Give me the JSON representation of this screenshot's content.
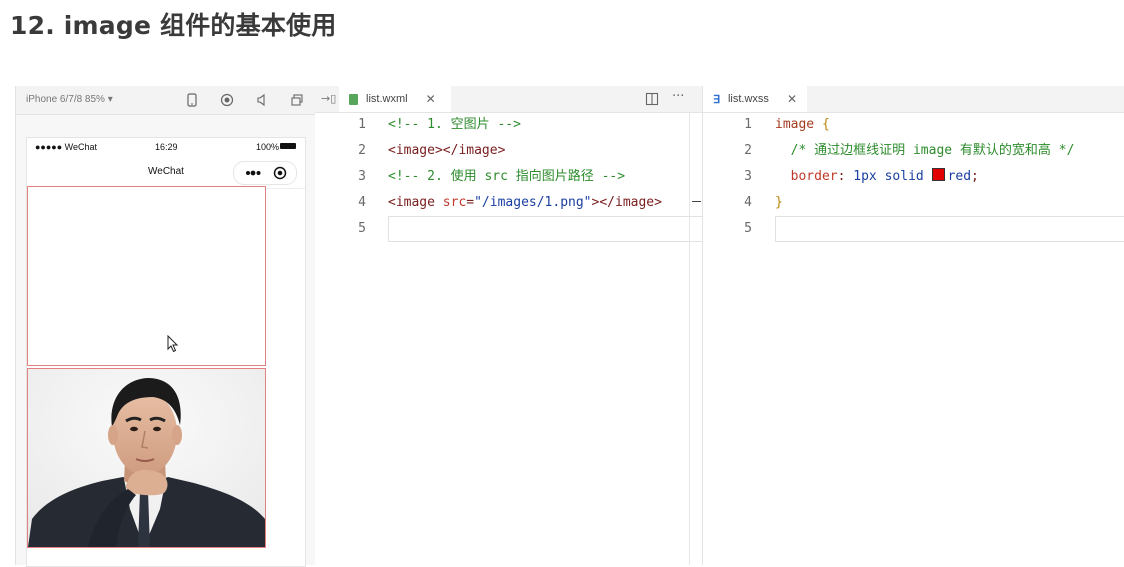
{
  "page_title": "12. image 组件的基本使用",
  "simulator": {
    "device_label": "iPhone 6/7/8 85% ▾",
    "status": {
      "carrier": "●●●●● WeChat",
      "time": "16:29",
      "battery": "100%"
    },
    "nav_title": "WeChat"
  },
  "wxml_editor": {
    "tab_label": "list.wxml",
    "file_icon": "wxml-file-icon",
    "lines": [
      {
        "no": "1",
        "parts": [
          {
            "t": "<!-- 1. 空图片 -->",
            "c": "c-comment"
          }
        ]
      },
      {
        "no": "2",
        "parts": [
          {
            "t": "<image></image>",
            "c": "c-tag"
          }
        ]
      },
      {
        "no": "3",
        "parts": [
          {
            "t": "<!-- 2. 使用 src 指向图片路径 -->",
            "c": "c-comment"
          }
        ]
      },
      {
        "no": "4",
        "parts": [
          {
            "t": "<image ",
            "c": "c-tag"
          },
          {
            "t": "src",
            "c": "c-attr"
          },
          {
            "t": "=",
            "c": "c-tag"
          },
          {
            "t": "\"/images/1.png\"",
            "c": "c-str"
          },
          {
            "t": "></image>",
            "c": "c-tag"
          }
        ]
      },
      {
        "no": "5",
        "parts": []
      }
    ]
  },
  "wxss_editor": {
    "tab_label": "list.wxss",
    "file_icon": "css-file-icon",
    "lines": [
      {
        "no": "1",
        "parts": [
          {
            "t": "image ",
            "c": "c-sel"
          },
          {
            "t": "{",
            "c": "c-brace"
          }
        ]
      },
      {
        "no": "2",
        "parts": [
          {
            "t": "  /* 通过边框线证明 image 有默认的宽和高 */",
            "c": "c-comment"
          }
        ]
      },
      {
        "no": "3",
        "parts": [
          {
            "t": "  border",
            "c": "c-prop"
          },
          {
            "t": ": ",
            "c": "c-tag"
          },
          {
            "t": "1px solid ",
            "c": "c-val"
          },
          {
            "t": "SWATCH",
            "c": "swatch"
          },
          {
            "t": "red",
            "c": "c-val"
          },
          {
            "t": ";",
            "c": "c-tag"
          }
        ]
      },
      {
        "no": "4",
        "parts": [
          {
            "t": "}",
            "c": "c-brace"
          }
        ]
      },
      {
        "no": "5",
        "parts": []
      }
    ]
  },
  "colors": {
    "border_red": "#e38080",
    "swatch_red": "#e00000"
  }
}
